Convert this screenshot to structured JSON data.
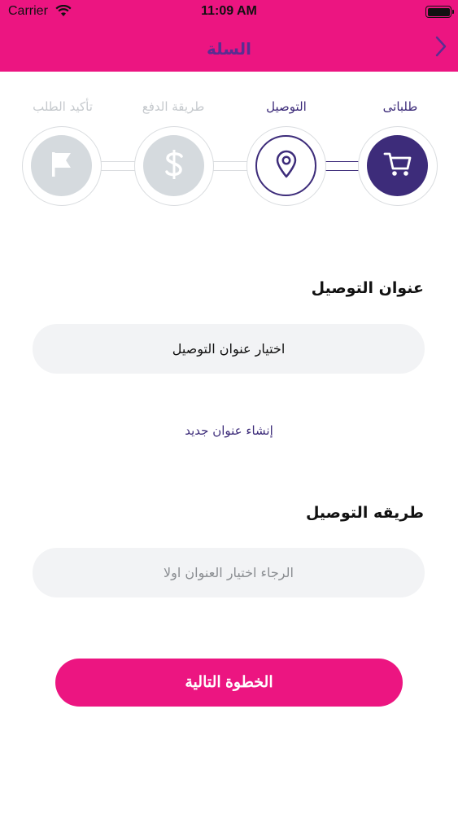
{
  "status_bar": {
    "carrier": "Carrier",
    "time": "11:09 AM"
  },
  "header": {
    "title": "السلة",
    "back_icon": "chevron-right-icon"
  },
  "stepper": {
    "steps": [
      {
        "label": "طلباتى",
        "icon": "cart-icon",
        "state": "completed"
      },
      {
        "label": "التوصيل",
        "icon": "location-pin-icon",
        "state": "current"
      },
      {
        "label": "طريقة الدفع",
        "icon": "dollar-icon",
        "state": "pending"
      },
      {
        "label": "تأكيد الطلب",
        "icon": "flag-icon",
        "state": "pending"
      }
    ]
  },
  "delivery_address": {
    "title": "عنوان التوصيل",
    "select_label": "اختيار عنوان التوصيل",
    "create_link": "إنشاء عنوان جديد"
  },
  "delivery_method": {
    "title": "طريقه التوصيل",
    "placeholder": "الرجاء اختيار العنوان اولا"
  },
  "next_button": {
    "label": "الخطوة التالية"
  },
  "colors": {
    "brand_pink": "#ec1581",
    "brand_purple": "#3d2c7a",
    "title_purple": "#5a2d91",
    "inactive_gray": "#d5dade",
    "field_bg": "#f2f3f5"
  }
}
